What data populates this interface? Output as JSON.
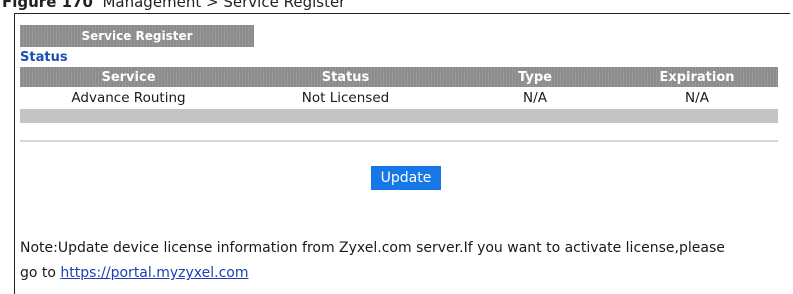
{
  "caption": {
    "figure": "Figure 170",
    "text": "Management > Service Register"
  },
  "panel_title": "Service Register",
  "status_heading": "Status",
  "table": {
    "headers": [
      "Service",
      "Status",
      "Type",
      "Expiration"
    ],
    "rows": [
      [
        "Advance Routing",
        "Not Licensed",
        "N/A",
        "N/A"
      ]
    ]
  },
  "update_label": "Update",
  "note": {
    "line1": "Note:Update device license information from Zyxel.com server.If you want to activate license,please",
    "prefix": "go to ",
    "link": "https://portal.myzyxel.com"
  },
  "colors": {
    "header_gray": "#8c8c8c",
    "status_blue": "#1d4fb3",
    "button_blue": "#1677e6",
    "link_blue": "#1d3fb8"
  }
}
